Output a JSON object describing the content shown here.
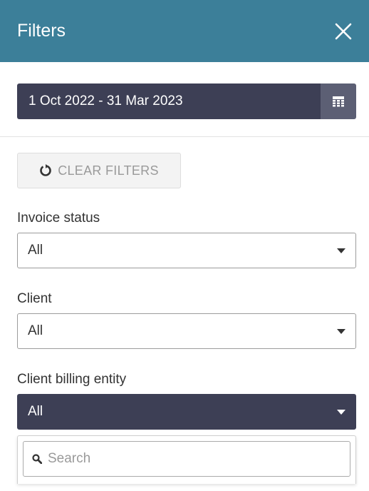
{
  "header": {
    "title": "Filters",
    "close_icon": "close-icon"
  },
  "date_range": {
    "value": "1 Oct 2022 - 31 Mar 2023",
    "calendar_icon": "calendar-icon"
  },
  "clear_filters": {
    "label": "CLEAR FILTERS",
    "icon": "refresh-icon"
  },
  "filters": {
    "invoice_status": {
      "label": "Invoice status",
      "value": "All"
    },
    "client": {
      "label": "Client",
      "value": "All"
    },
    "client_billing_entity": {
      "label": "Client billing entity",
      "value": "All",
      "search_placeholder": "Search",
      "search_icon": "search-icon"
    }
  },
  "colors": {
    "header_bg": "#3c7f99",
    "dark_field": "#3d3f55",
    "calendar_btn": "#5c5f74"
  }
}
